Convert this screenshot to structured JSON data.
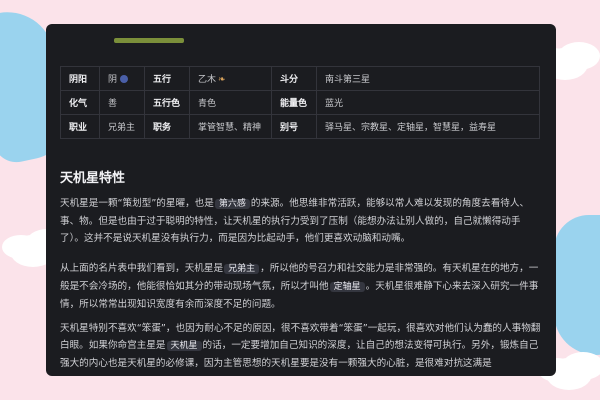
{
  "table": {
    "rows": [
      [
        {
          "key": "阴阳",
          "value": "阴"
        },
        {
          "key": "五行",
          "value": "乙木"
        },
        {
          "key": "斗分",
          "value": "南斗第三星"
        }
      ],
      [
        {
          "key": "化气",
          "value": "善"
        },
        {
          "key": "五行色",
          "value": "青色"
        },
        {
          "key": "能量色",
          "value": "蓝光"
        }
      ],
      [
        {
          "key": "职业",
          "value": "兄弟主"
        },
        {
          "key": "职务",
          "value": "掌管智慧、精神"
        },
        {
          "key": "别号",
          "value": "驿马星、宗教星、定轴星，智慧星，益寿星"
        }
      ]
    ]
  },
  "section_title": "天机星特性",
  "p1": {
    "a": "天机星是一颗“策划型”的星曜，也是",
    "tag": "第六感",
    "b": "的来源。他思维非常活跃，能够以常人难以发现的角度去看待人、事、物。但是也由于过于聪明的特性，让天机星的执行力受到了压制（能想办法让别人做的，自己就懒得动手了）。这并不是说天机星没有执行力，而是因为比起动手，他们更喜欢动脑和动嘴。"
  },
  "p2": {
    "a": "从上面的名片表中我们看到，天机星是",
    "tag1": "兄弟主",
    "b": "，所以他的号召力和社交能力是非常强的。有天机星在的地方，一般是不会冷场的，他能很恰如其分的带动现场气氛，所以才叫他",
    "tag2": "定轴星",
    "c": "。天机星很难静下心来去深入研究一件事情，所以常常出现知识宽度有余而深度不足的问题。"
  },
  "p3": {
    "a": "天机星特别不喜欢“笨蛋”，也因为耐心不足的原因，很不喜欢带着“笨蛋”一起玩，很喜欢对他们认为蠢的人事物翻白眼。如果你命宫主星是",
    "tag": "天机星",
    "b": "的话，一定要增加自己知识的深度，让自己的想法变得可执行。另外，锻炼自己强大的内心也是天机星的必修课，因为主管思想的天机星要是没有一颗强大的心脏，是很难对抗这满是"
  }
}
